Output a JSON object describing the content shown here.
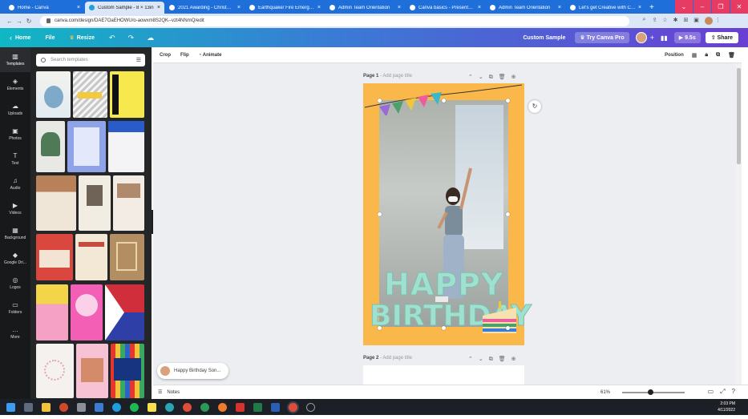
{
  "browser": {
    "tabs": [
      {
        "title": "Home - Canva",
        "active": false
      },
      {
        "title": "Custom Sample - 8 × 13in",
        "active": true
      },
      {
        "title": "2021 Awarding - Christmas",
        "active": false
      },
      {
        "title": "Earthquake/ Fire Emergency",
        "active": false
      },
      {
        "title": "Admin Team Orientation",
        "active": false
      },
      {
        "title": "Canva basics - Presentation",
        "active": false
      },
      {
        "title": "Admin Team Orientation",
        "active": false
      },
      {
        "title": "Let's get Creative with Canva",
        "active": false
      }
    ],
    "new_tab": "+",
    "url": "canva.com/design/DAE7OaEHOWU/o-aowxm8S2QK--vzt4NNmQ/edit"
  },
  "canva_header": {
    "home": "Home",
    "file": "File",
    "resize": "Resize",
    "design_title": "Custom Sample",
    "try_pro": "Try Canva Pro",
    "play_time": "9.5s",
    "share": "Share"
  },
  "rail": [
    {
      "label": "Templates",
      "icon": "templates-icon",
      "glyph": "▥"
    },
    {
      "label": "Elements",
      "icon": "elements-icon",
      "glyph": "◈"
    },
    {
      "label": "Uploads",
      "icon": "uploads-icon",
      "glyph": "☁"
    },
    {
      "label": "Photos",
      "icon": "photos-icon",
      "glyph": "▣"
    },
    {
      "label": "Text",
      "icon": "text-icon",
      "glyph": "T"
    },
    {
      "label": "Audio",
      "icon": "audio-icon",
      "glyph": "♫"
    },
    {
      "label": "Videos",
      "icon": "videos-icon",
      "glyph": "▶"
    },
    {
      "label": "Background",
      "icon": "background-icon",
      "glyph": "▦"
    },
    {
      "label": "Google Dri...",
      "icon": "google-drive-icon",
      "glyph": "◆"
    },
    {
      "label": "Logos",
      "icon": "logos-icon",
      "glyph": "◎"
    },
    {
      "label": "Folders",
      "icon": "folders-icon",
      "glyph": "▭"
    },
    {
      "label": "More",
      "icon": "more-icon",
      "glyph": "…"
    }
  ],
  "templates_panel": {
    "search_placeholder": "Search templates"
  },
  "context_toolbar": {
    "crop": "Crop",
    "flip": "Flip",
    "animate": "Animate",
    "position": "Position"
  },
  "page1": {
    "label": "Page 1",
    "add_title": "- Add page title",
    "text_line1": "HAPPY",
    "text_line2": "BIRTHDAY"
  },
  "page2": {
    "label": "Page 2",
    "add_title": "- Add page title"
  },
  "toast": {
    "text": "Happy Birthday Son..."
  },
  "bottom_bar": {
    "notes": "Notes",
    "zoom": "61%",
    "zoom_level": 0.61
  },
  "taskbar": {
    "time": "2:03 PM",
    "date": "4/11/2022"
  },
  "colors": {
    "canvas_background": "#fbb84a",
    "header_gradient_start": "#10b7c4",
    "header_gradient_end": "#6a3fd3",
    "tab_strip": "#1f6fdb",
    "window_control": "#e83b63"
  }
}
